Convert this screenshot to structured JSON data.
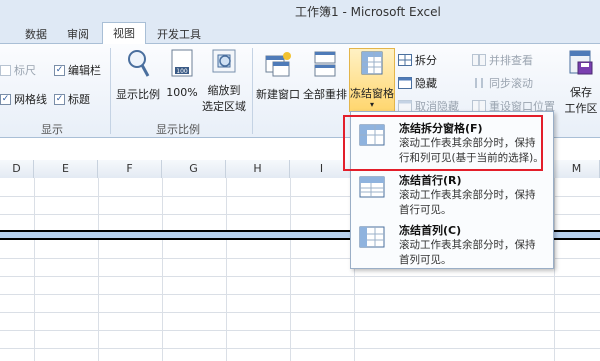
{
  "window": {
    "title": "工作簿1 - Microsoft Excel"
  },
  "tabs": [
    {
      "label": "数据"
    },
    {
      "label": "审阅"
    },
    {
      "label": "视图"
    },
    {
      "label": "开发工具"
    }
  ],
  "ribbon": {
    "show_group": {
      "ruler": "标尺",
      "formula_bar": "编辑栏",
      "gridlines": "网格线",
      "headings": "标题",
      "label": "显示"
    },
    "zoom_group": {
      "zoom": "显示比例",
      "zoom_100": "100%",
      "zoom_selection": [
        "缩放到",
        "选定区域"
      ],
      "label": "显示比例"
    },
    "window_group": {
      "new_window": "新建窗口",
      "arrange_all": "全部重排",
      "freeze_panes": "冻结窗格",
      "split": "拆分",
      "hide": "隐藏",
      "unhide": "取消隐藏",
      "side_by_side": "并排查看",
      "sync_scroll": "同步滚动",
      "reset_position": "重设窗口位置",
      "save_workspace": [
        "保存",
        "工作区"
      ]
    }
  },
  "columns": [
    "D",
    "E",
    "F",
    "G",
    "H",
    "I",
    "M"
  ],
  "freeze_menu": [
    {
      "title": "冻结拆分窗格(F)",
      "desc": [
        "滚动工作表其余部分时，保持",
        "行和列可见(基于当前的选择)。"
      ]
    },
    {
      "title": "冻结首行(R)",
      "desc": [
        "滚动工作表其余部分时，保持",
        "首行可见。"
      ]
    },
    {
      "title": "冻结首列(C)",
      "desc": [
        "滚动工作表其余部分时，保持",
        "首列可见。"
      ]
    }
  ],
  "colors": {
    "highlight": "#ffd66e",
    "selection_row": "#b7d0ee",
    "callout": "#e31e2a"
  }
}
